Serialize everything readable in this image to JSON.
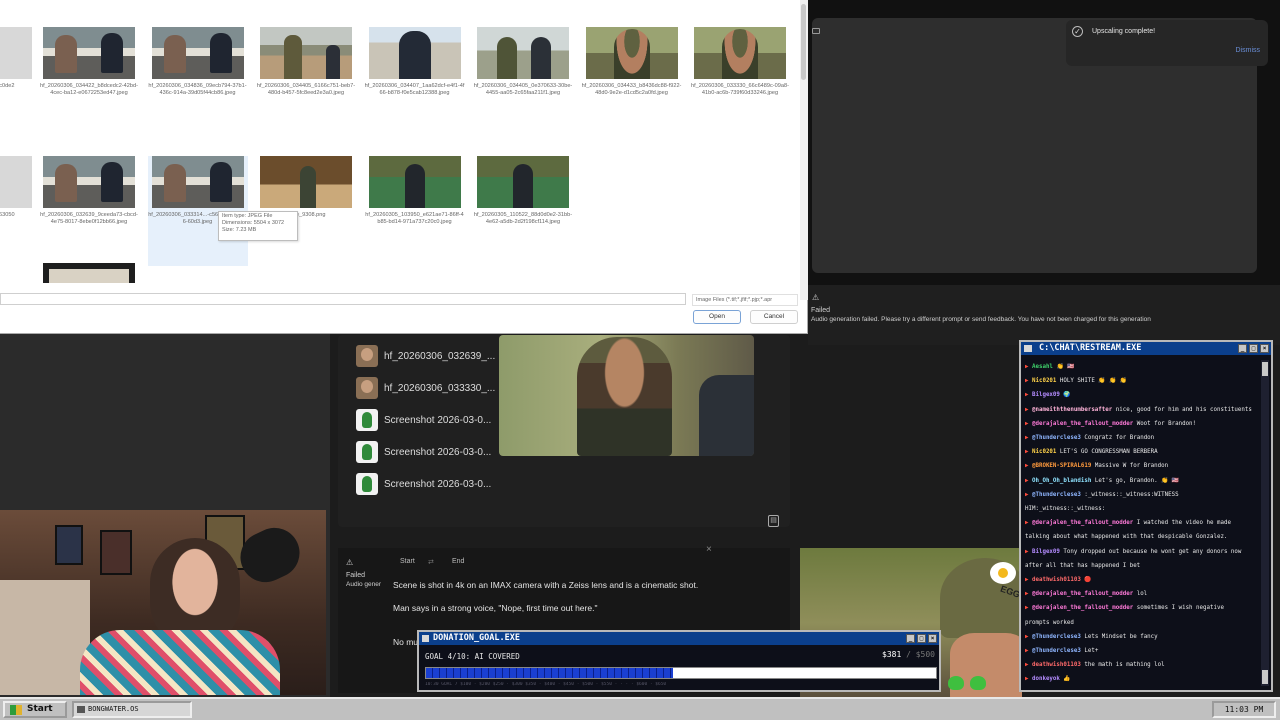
{
  "toast": {
    "title": "Upscaling complete!",
    "dismiss": "Dismiss"
  },
  "failed_top": {
    "label": "Failed",
    "message": "Audio generation failed. Please try a different prompt or send feedback. You have not been charged for this generation"
  },
  "file_dialog": {
    "row1": [
      {
        "caption": "...ac597910 ...82c0de2",
        "kind": "partial"
      },
      {
        "caption": "hf_20260306_034422_b8dcedc2-42bd-4cec-ba12-e0672253ed47.jpeg",
        "kind": "diner"
      },
      {
        "caption": "hf_20260306_034836_09ecb794-37b1-436c-914a-39d05f44cb86.jpeg",
        "kind": "diner"
      },
      {
        "caption": "hf_20260306_034405_6166c751-beb7-480d-b457-5fc8eed2e3a0.jpeg",
        "kind": "river"
      },
      {
        "caption": "hf_20260306_034407_1aa62dcf-e4f1-4f66-b878-f0e5cab12388.jpeg",
        "kind": "suitman"
      },
      {
        "caption": "hf_20260306_034405_0e370633-30be-4455-aa05-2c65faa211f1.jpeg",
        "kind": "backs"
      },
      {
        "caption": "hf_20260306_034433_b8436dc88-f922-48d0-9e2e-d1cd5c2a0fd.jpeg",
        "kind": "helmet"
      },
      {
        "caption": "hf_20260306_033330_66c6489c-09a8-41b0-ac6b-739f60d33246.jpeg",
        "kind": "helmet"
      }
    ],
    "row2": [
      {
        "caption": "...64992d6 ...1c763050",
        "kind": "partial"
      },
      {
        "caption": "hf_20260306_032639_9ceeda73-cbcd-4e75-8017-8ebe0f12bb66.jpeg",
        "kind": "diner"
      },
      {
        "caption": "hf_20260306_033314...-c563-4990-9e26-60d3.jpeg",
        "kind": "diner"
      },
      {
        "caption": "...me_9308.png",
        "kind": "bar"
      },
      {
        "caption": "hf_20260305_103950_e621ae71-86ff-4b85-bd14-971a737c20c0.jpeg",
        "kind": "crowd"
      },
      {
        "caption": "hf_20260305_110522_88d0d0e2-31bb-4e62-a5db-2d2f198cf114.jpeg",
        "kind": "crowd"
      }
    ],
    "tooltip": [
      "Item type: JPEG File",
      "Dimensions: 5504 x 3072",
      "Size: 7.23 MB"
    ],
    "filetype": "Image Files (*.tif;*.jfif;*.pjp;*.apr",
    "open": "Open",
    "cancel": "Cancel"
  },
  "files_panel": {
    "items": [
      {
        "label": "hf_20260306_032639_...",
        "thumb": "face"
      },
      {
        "label": "hf_20260306_033330_...",
        "thumb": "face"
      },
      {
        "label": "Screenshot 2026-03-0...",
        "thumb": "green"
      },
      {
        "label": "Screenshot 2026-03-0...",
        "thumb": "green"
      },
      {
        "label": "Screenshot 2026-03-0...",
        "thumb": "green"
      }
    ]
  },
  "gen_panel": {
    "start": "Start",
    "end": "End",
    "failed": "Failed",
    "audio": "Audio gener",
    "prompt1": "Scene is shot in 4k on an IMAX camera with a Zeiss lens and is a cinematic shot.",
    "prompt2": "Man says in a strong voice, \"Nope, first time out here.\"",
    "prompt3": "No mu"
  },
  "helmet_text": "EGGM",
  "chat": {
    "title": "C:\\CHAT\\RESTREAM.EXE",
    "lines": [
      {
        "user": "Aesahl",
        "uc": "#3fd26b",
        "text": "👏 🇺🇸"
      },
      {
        "user": "Nic0201",
        "uc": "#ffd24a",
        "text": "HOLY SHITE 👏 👏 👏"
      },
      {
        "user": "Bilgex09",
        "uc": "#b48cff",
        "text": "🌍"
      },
      {
        "user": "@nameiththenumbersafter",
        "uc": "#ffb3d9",
        "text": "nice, good for him and his constituents"
      },
      {
        "user": "@derajalen_the_fallout_modder",
        "uc": "#ff7ad9",
        "text": "Woot for Brandon!"
      },
      {
        "user": "@Thunderclese3",
        "uc": "#8fb6ff",
        "text": "Congratz for Brandon"
      },
      {
        "user": "Nic0201",
        "uc": "#ffd24a",
        "text": "LET'S GO CONGRESSMAN BERBERA"
      },
      {
        "user": "@BROKEN-SPIRAL619",
        "uc": "#ff9a3d",
        "text": "Massive W for Brandon"
      },
      {
        "user": "Oh_Oh_Oh_blandish",
        "uc": "#8fe3ff",
        "text": "Let's go, Brandon. 👏 🇺🇸"
      },
      {
        "user": "@Thunderclese3",
        "uc": "#8fb6ff",
        "text": ":_witness::_witness:WITNESS"
      },
      {
        "user": "",
        "uc": "#e9e9e9",
        "text": "HIM:_witness::_witness:"
      },
      {
        "user": "@derajalen_the_fallout_modder",
        "uc": "#ff7ad9",
        "text": "I watched the video he made"
      },
      {
        "user": "",
        "uc": "#e9e9e9",
        "text": "talking about what happened with that despicable Gonzalez."
      },
      {
        "user": "Bilgex09",
        "uc": "#b48cff",
        "text": "Tony dropped out because he wont get any donors now"
      },
      {
        "user": "",
        "uc": "#e9e9e9",
        "text": "after all that has happened I bet"
      },
      {
        "user": "deathwish01103",
        "uc": "#ff6a6a",
        "text": "🔴"
      },
      {
        "user": "@derajalen_the_fallout_modder",
        "uc": "#ff7ad9",
        "text": "lol"
      },
      {
        "user": "@derajalen_the_fallout_modder",
        "uc": "#ff7ad9",
        "text": "sometimes I wish negative"
      },
      {
        "user": "",
        "uc": "#e9e9e9",
        "text": "prompts worked"
      },
      {
        "user": "@Thunderclese3",
        "uc": "#8fb6ff",
        "text": "Lets Mindset be fancy"
      },
      {
        "user": "@Thunderclese3",
        "uc": "#8fb6ff",
        "text": "Let+"
      },
      {
        "user": "deathwish01103",
        "uc": "#ff6a6a",
        "text": "the math is mathing lol"
      },
      {
        "user": "donkeyok",
        "uc": "#b48cff",
        "text": "👍"
      }
    ]
  },
  "donation": {
    "title": "DONATION_GOAL.EXE",
    "goal": "GOAL 4/10: AI COVERED",
    "raised": "$381",
    "target": "/ $500",
    "progress": 0.485,
    "ticks": "10:30 GOAL 7 $100 · $200 $250 · $300 $350 · $400 · $450 · $500 · $550 ·  ·  ·  · $600 · $650"
  },
  "taskbar": {
    "start": "Start",
    "item": "BONGWATER.OS",
    "clock": "11:03 PM"
  }
}
